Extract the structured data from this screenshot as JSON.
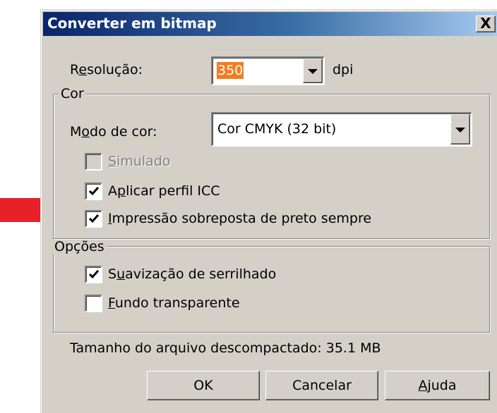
{
  "dialog": {
    "title": "Converter em bitmap",
    "close_label": "X"
  },
  "resolution": {
    "label_pre": "R",
    "label_mn": "e",
    "label_post": "solução:",
    "value": "350",
    "unit": "dpi"
  },
  "cor_group": {
    "legend": "Cor",
    "color_mode": {
      "label_pre": "M",
      "label_mn": "o",
      "label_post": "do de cor:",
      "value": "Cor CMYK (32 bit)"
    },
    "simulated": {
      "mn": "S",
      "label": "imulado",
      "checked": false,
      "enabled": false
    },
    "apply_icc": {
      "pre": "A",
      "mn": "p",
      "label": "licar perfil ICC",
      "checked": true
    },
    "overprint_black": {
      "mn": "I",
      "label": "mpressão sobreposta de preto sempre",
      "checked": true
    }
  },
  "opcoes_group": {
    "legend": "Opções",
    "antialias": {
      "pre": "S",
      "mn": "u",
      "label": "avização de serrilhado",
      "checked": true
    },
    "transparent_bg": {
      "mn": "F",
      "label": "undo transparente",
      "checked": false
    }
  },
  "file_size": {
    "text": "Tamanho do arquivo descompactado: 35.1 MB"
  },
  "buttons": {
    "ok": "OK",
    "cancel": "Cancelar",
    "help_mn": "A",
    "help_rest": "juda"
  },
  "annotation": {
    "arrow_color": "#e8202a"
  },
  "colors": {
    "dialog_bg": "#d4d0c8",
    "title_start": "#0a246a",
    "title_end": "#a6caf0",
    "selection": "#f47c20"
  }
}
